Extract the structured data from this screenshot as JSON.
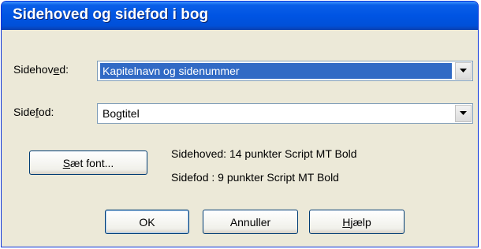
{
  "window": {
    "title": "Sidehoved og sidefod i bog"
  },
  "header": {
    "label_before": "Sidehov",
    "label_access": "e",
    "label_after": "d:",
    "value": "Kapitelnavn og sidenummer"
  },
  "footer": {
    "label_before": "Side",
    "label_access": "f",
    "label_after": "od:",
    "value": "Bogtitel"
  },
  "font_button": {
    "label_access": "S",
    "label_after": "æt font..."
  },
  "info": {
    "header_font": "Sidehoved: 14 punkter Script MT Bold",
    "footer_font": "Sidefod  : 9 punkter Script MT Bold"
  },
  "buttons": {
    "ok": "OK",
    "cancel": "Annuller",
    "help_access": "H",
    "help_after": "jælp"
  },
  "colors": {
    "title_bar": "#0054e3",
    "selection": "#316ac5",
    "dialog_bg": "#ece9d8"
  }
}
